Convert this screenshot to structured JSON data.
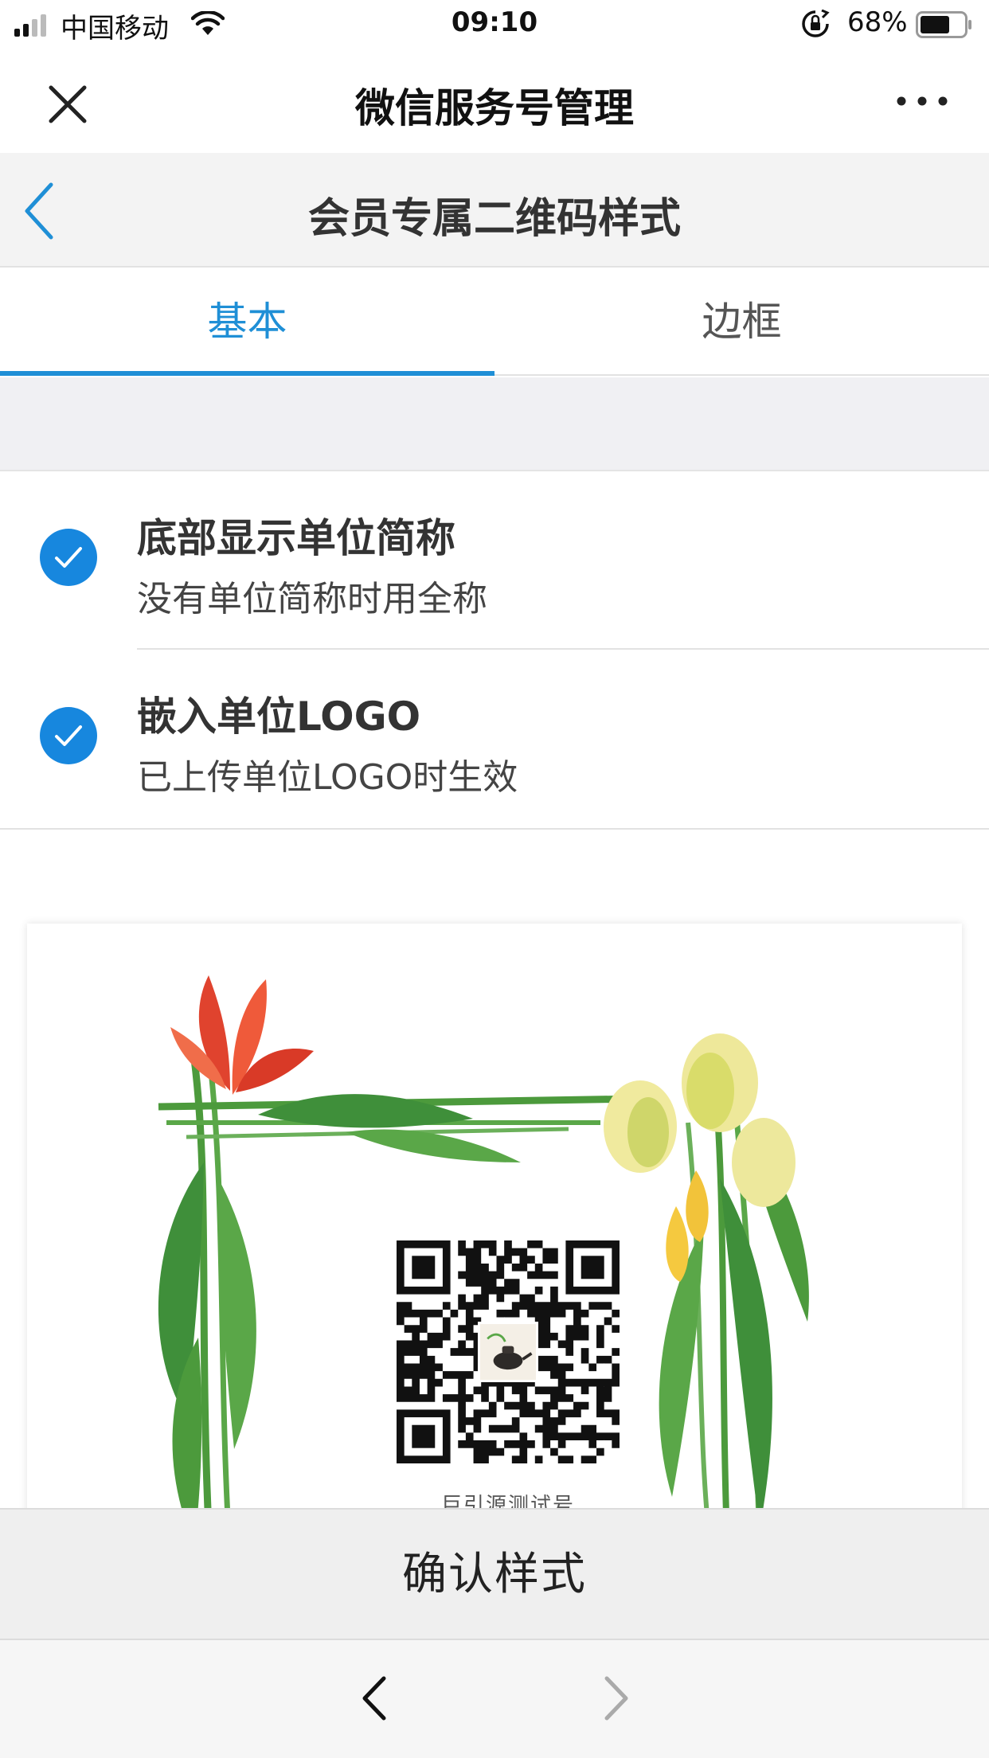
{
  "status_bar": {
    "carrier": "中国移动",
    "time": "09:10",
    "battery_percent": "68%",
    "battery_level": 0.68,
    "icons": [
      "signal-icon",
      "wifi-icon",
      "rotation-lock-icon",
      "battery-icon"
    ]
  },
  "nav_bar": {
    "title": "微信服务号管理",
    "close_icon": "close-icon",
    "more_icon": "more-icon"
  },
  "page_header": {
    "title": "会员专属二维码样式",
    "back_icon": "chevron-left-icon"
  },
  "tabs": [
    {
      "label": "基本",
      "active": true
    },
    {
      "label": "边框",
      "active": false
    }
  ],
  "options": [
    {
      "title": "底部显示单位简称",
      "subtitle": "没有单位简称时用全称",
      "checked": true
    },
    {
      "title": "嵌入单位LOGO",
      "subtitle": "已上传单位LOGO时生效",
      "checked": true
    }
  ],
  "preview": {
    "caption": "巨引源测试号",
    "image": "flower-frame-qr-code"
  },
  "confirm": {
    "label": "确认样式"
  },
  "browser_toolbar": {
    "back_icon": "chevron-left-icon",
    "forward_icon": "chevron-right-icon"
  },
  "colors": {
    "accent": "#1f8fd6",
    "check": "#1787de",
    "header_bg": "#f3f3f3",
    "confirm_bg": "#efefef"
  }
}
